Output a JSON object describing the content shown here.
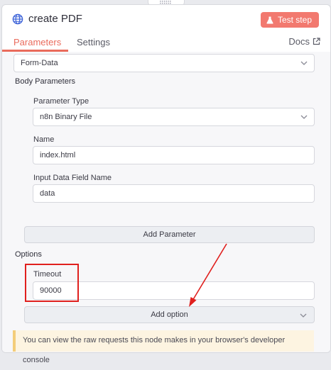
{
  "node": {
    "title": "create PDF",
    "test_button_label": "Test step"
  },
  "tabs": {
    "parameters": "Parameters",
    "settings": "Settings",
    "docs": "Docs"
  },
  "body_content_type": {
    "value": "Form-Data"
  },
  "body_parameters": {
    "heading": "Body Parameters",
    "parameter_type_label": "Parameter Type",
    "parameter_type_value": "n8n Binary File",
    "name_label": "Name",
    "name_value": "index.html",
    "input_field_label": "Input Data Field Name",
    "input_field_value": "data",
    "add_parameter_label": "Add Parameter"
  },
  "options": {
    "heading": "Options",
    "timeout_label": "Timeout",
    "timeout_value": "90000",
    "add_option_label": "Add option"
  },
  "notice": {
    "text": "You can view the raw requests this node makes in your browser's developer console"
  },
  "colors": {
    "accent": "#ea6b5c",
    "test_button": "#f2796f",
    "annotation_red": "#e0201e",
    "notice_border": "#f3cd7a"
  },
  "icons": [
    "globe-icon",
    "flask-icon",
    "external-link-icon",
    "chevron-down-icon",
    "drag-handle-icon"
  ]
}
